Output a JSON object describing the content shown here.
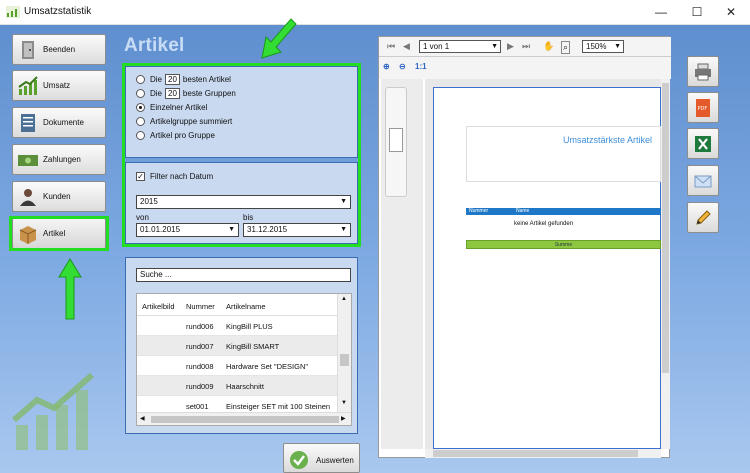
{
  "window": {
    "title": "Umsatzstatistik",
    "minimize": "—",
    "maximize": "☐",
    "close": "✕"
  },
  "nav": {
    "items": [
      {
        "label": "Beenden"
      },
      {
        "label": "Umsatz"
      },
      {
        "label": "Dokumente"
      },
      {
        "label": "Zahlungen"
      },
      {
        "label": "Kunden"
      },
      {
        "label": "Artikel"
      }
    ]
  },
  "page_title": "Artikel",
  "options": {
    "best_articles_prefix": "Die",
    "best_articles_count": "20",
    "best_articles_suffix": "besten Artikel",
    "best_groups_prefix": "Die",
    "best_groups_count": "20",
    "best_groups_suffix": "beste Gruppen",
    "single_article": "Einzelner Artikel",
    "group_summed": "Artikelgruppe summiert",
    "per_group": "Artikel pro Gruppe",
    "selected": "single_article"
  },
  "filter": {
    "label": "Filter nach Datum",
    "checked": true,
    "year": "2015",
    "from_label": "von",
    "from_value": "01.01.2015",
    "to_label": "bis",
    "to_value": "31.12.2015"
  },
  "search": {
    "placeholder": "Suche ..."
  },
  "table": {
    "headers": [
      "Artikelbild",
      "Nummer",
      "Artikelname"
    ],
    "rows": [
      {
        "image": "",
        "number": "rund006",
        "name": "KingBill PLUS"
      },
      {
        "image": "",
        "number": "rund007",
        "name": "KingBill SMART"
      },
      {
        "image": "",
        "number": "rund008",
        "name": "Hardware Set \"DESIGN\""
      },
      {
        "image": "",
        "number": "rund009",
        "name": "Haarschnitt"
      },
      {
        "image": "",
        "number": "set001",
        "name": "Einsteiger SET mit 100 Steinen"
      }
    ]
  },
  "evaluate_button": {
    "label": "Auswerten"
  },
  "viewer": {
    "page_indicator": "1 von 1",
    "zoom": "150%",
    "zoom_reset": "1:1",
    "report": {
      "title": "Umsatzstärkste Artikel",
      "col_number": "Nummer",
      "col_name": "Name",
      "empty_text": "keine Artikel gefunden",
      "sum_label": "Summe"
    }
  },
  "tools": [
    "printer-icon",
    "pdf-icon",
    "excel-icon",
    "email-icon",
    "pencil-icon"
  ],
  "colors": {
    "highlight": "#22dd22",
    "panel": "#c9d9f0",
    "accent": "#3f8fd8"
  }
}
